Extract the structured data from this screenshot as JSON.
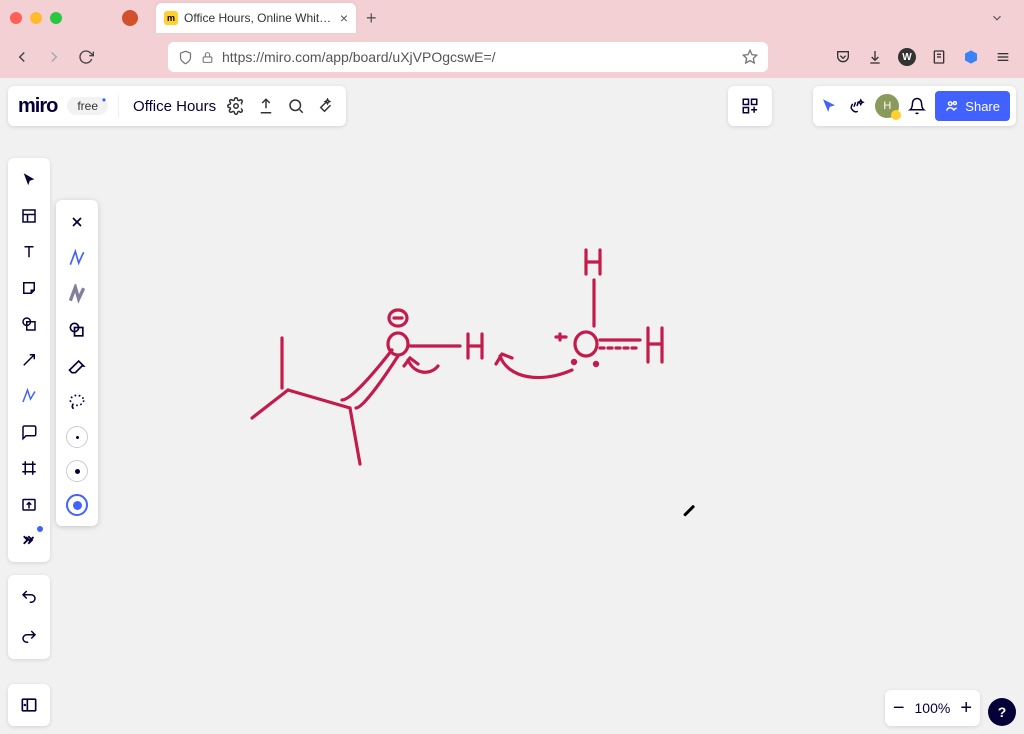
{
  "browser": {
    "tab_title": "Office Hours, Online Whiteboard",
    "url": "https://miro.com/app/board/uXjVPOgcswE=/"
  },
  "header": {
    "logo": "miro",
    "plan": "free",
    "board_name": "Office Hours",
    "share_label": "Share",
    "avatar_initial": "H"
  },
  "zoom": {
    "level": "100%"
  },
  "help": {
    "label": "?"
  }
}
